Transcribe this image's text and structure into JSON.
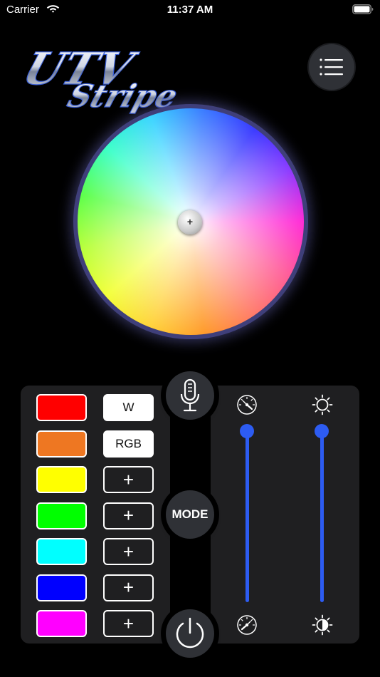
{
  "status_bar": {
    "carrier": "Carrier",
    "time": "11:37 AM",
    "icons": [
      "wifi-icon",
      "battery-icon"
    ]
  },
  "header": {
    "logo_text": "UTV Stripe",
    "menu_icon": "list-icon"
  },
  "color_wheel": {
    "selected_color": "#ffffff",
    "knob_icon": "crosshair-icon"
  },
  "presets": {
    "colors": [
      {
        "name": "red",
        "hex": "#ff0000"
      },
      {
        "name": "orange",
        "hex": "#ee7722"
      },
      {
        "name": "yellow",
        "hex": "#ffff00"
      },
      {
        "name": "green",
        "hex": "#00ff00"
      },
      {
        "name": "cyan",
        "hex": "#00ffff"
      },
      {
        "name": "blue",
        "hex": "#0000ff"
      },
      {
        "name": "magenta",
        "hex": "#ff00ff"
      }
    ],
    "slots": [
      "W",
      "RGB",
      "+",
      "+",
      "+",
      "+",
      "+"
    ]
  },
  "buttons": {
    "mic_icon": "microphone-icon",
    "mode_label": "MODE",
    "power_icon": "power-icon"
  },
  "sliders": {
    "speed": {
      "icon_top": "speedometer-fast-icon",
      "icon_bottom": "speedometer-slow-icon",
      "level": 1.0
    },
    "brightness": {
      "icon_top": "sun-icon",
      "icon_bottom": "half-sun-icon",
      "level": 1.0
    },
    "accent_color": "#2d5cf2"
  }
}
